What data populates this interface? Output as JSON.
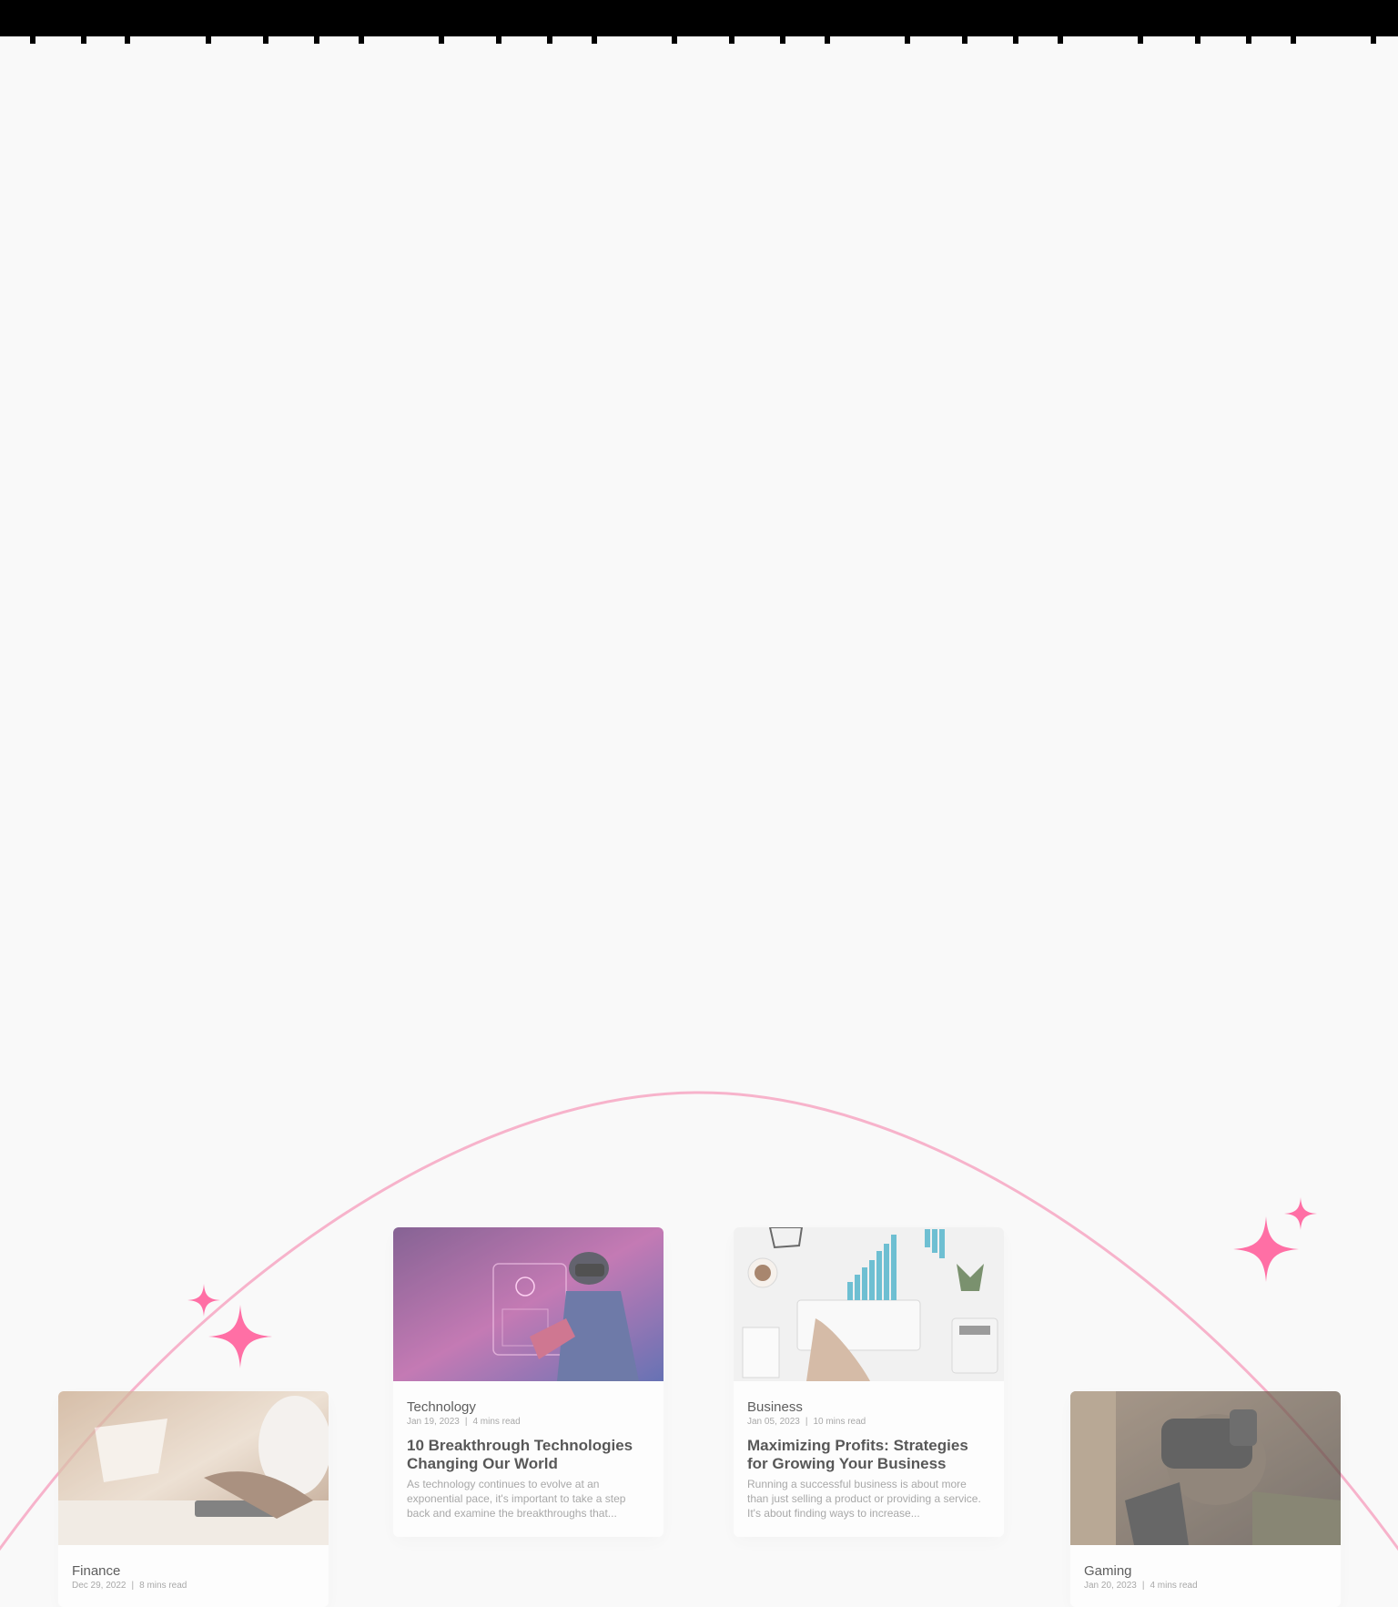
{
  "colors": {
    "background": "#f9f9f9",
    "accent_pink": "#ff6fa5",
    "arc_pink": "#f7b3cb",
    "top_bar": "#000000"
  },
  "decorations": {
    "sparkles": [
      "sparkle-icon",
      "sparkle-icon",
      "sparkle-icon",
      "sparkle-icon"
    ]
  },
  "cards": [
    {
      "category": "Finance",
      "date": "Dec 29, 2022",
      "read_time": "8 mins read",
      "title": "",
      "excerpt": "",
      "image": "finance-calculator-photo"
    },
    {
      "category": "Technology",
      "date": "Jan 19, 2023",
      "read_time": "4 mins read",
      "title": "10 Breakthrough Technologies Changing Our World",
      "excerpt": "As technology continues to evolve at an exponential pace, it's important to take a step back and examine the breakthroughs that...",
      "image": "vr-hologram-photo"
    },
    {
      "category": "Business",
      "date": "Jan 05, 2023",
      "read_time": "10 mins read",
      "title": "Maximizing Profits: Strategies for Growing Your Business",
      "excerpt": "Running a successful business is about more than just selling a product or providing a service. It's about finding ways to increase...",
      "image": "business-desk-charts-photo"
    },
    {
      "category": "Gaming",
      "date": "Jan 20, 2023",
      "read_time": "4 mins read",
      "title": "",
      "excerpt": "",
      "image": "vr-soldier-photo"
    }
  ],
  "separator": "|"
}
